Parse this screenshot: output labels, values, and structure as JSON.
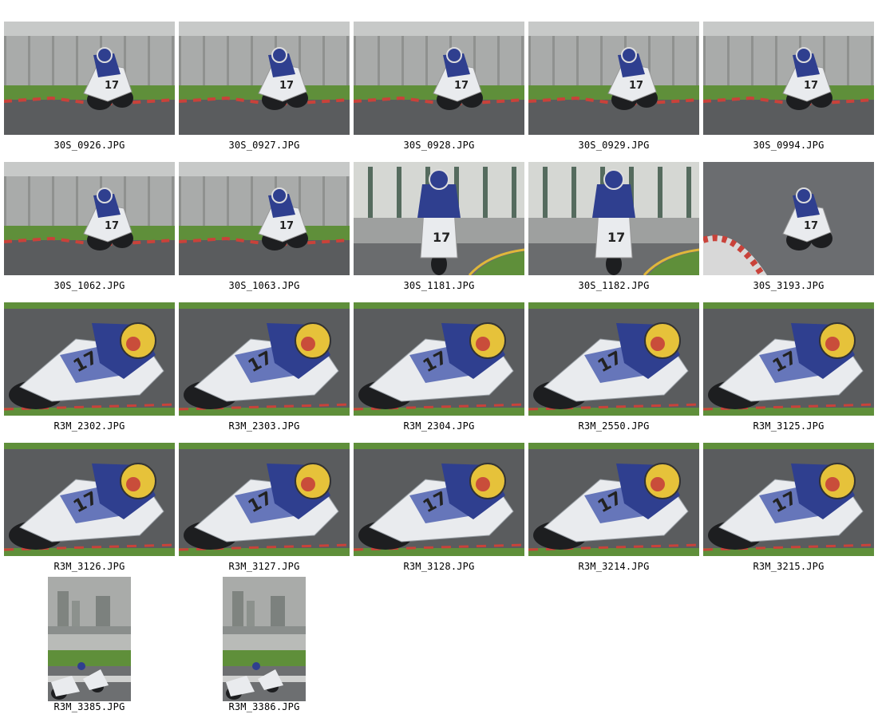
{
  "gallery": {
    "images": [
      {
        "filename": "30S_0926.JPG",
        "scene": "track-gray-wall",
        "bike": "white-17"
      },
      {
        "filename": "30S_0927.JPG",
        "scene": "track-gray-wall",
        "bike": "white-17"
      },
      {
        "filename": "30S_0928.JPG",
        "scene": "track-gray-wall",
        "bike": "white-17-front"
      },
      {
        "filename": "30S_0929.JPG",
        "scene": "track-gray-wall",
        "bike": "white-17-front"
      },
      {
        "filename": "30S_0994.JPG",
        "scene": "track-gray-wall",
        "bike": "white-17-close"
      },
      {
        "filename": "30S_1062.JPG",
        "scene": "track-gray-wall",
        "bike": "white-17-lean"
      },
      {
        "filename": "30S_1063.JPG",
        "scene": "track-gray-wall",
        "bike": "white-17-lean"
      },
      {
        "filename": "30S_1181.JPG",
        "scene": "track-pit-building",
        "bike": "white-17-head-on"
      },
      {
        "filename": "30S_1182.JPG",
        "scene": "track-pit-building",
        "bike": "white-17-head-on"
      },
      {
        "filename": "30S_3193.JPG",
        "scene": "track-corner-kerb",
        "bike": "white-17-lean"
      },
      {
        "filename": "R3M_2302.JPG",
        "scene": "closeup-lean",
        "bike": "white-17-closeup"
      },
      {
        "filename": "R3M_2303.JPG",
        "scene": "closeup-lean",
        "bike": "white-17-closeup"
      },
      {
        "filename": "R3M_2304.JPG",
        "scene": "closeup-lean",
        "bike": "white-17-closeup"
      },
      {
        "filename": "R3M_2550.JPG",
        "scene": "closeup-lean",
        "bike": "white-17-closeup"
      },
      {
        "filename": "R3M_3125.JPG",
        "scene": "closeup-lean",
        "bike": "white-17-closeup"
      },
      {
        "filename": "R3M_3126.JPG",
        "scene": "closeup-lean",
        "bike": "white-17-closeup"
      },
      {
        "filename": "R3M_3127.JPG",
        "scene": "closeup-lean",
        "bike": "white-17-closeup"
      },
      {
        "filename": "R3M_3128.JPG",
        "scene": "closeup-lean",
        "bike": "white-17-closeup"
      },
      {
        "filename": "R3M_3214.JPG",
        "scene": "closeup-lean",
        "bike": "white-17-closeup"
      },
      {
        "filename": "R3M_3215.JPG",
        "scene": "closeup-lean",
        "bike": "white-17-closeup"
      },
      {
        "filename": "R3M_3385.JPG",
        "scene": "portrait-city-skyline",
        "bike": "white-17-distant"
      },
      {
        "filename": "R3M_3386.JPG",
        "scene": "portrait-city-skyline",
        "bike": "white-17-distant"
      }
    ]
  },
  "colors": {
    "page_background": "#ffffff",
    "caption_text": "#000000",
    "track_asphalt": "#5a5c5e",
    "grass": "#5f8f3a",
    "barrier": "#a9abaa",
    "bike_white": "#e9ebee",
    "rider_blue": "#2f3f8f",
    "helmet_yellow": "#e6c23a"
  }
}
